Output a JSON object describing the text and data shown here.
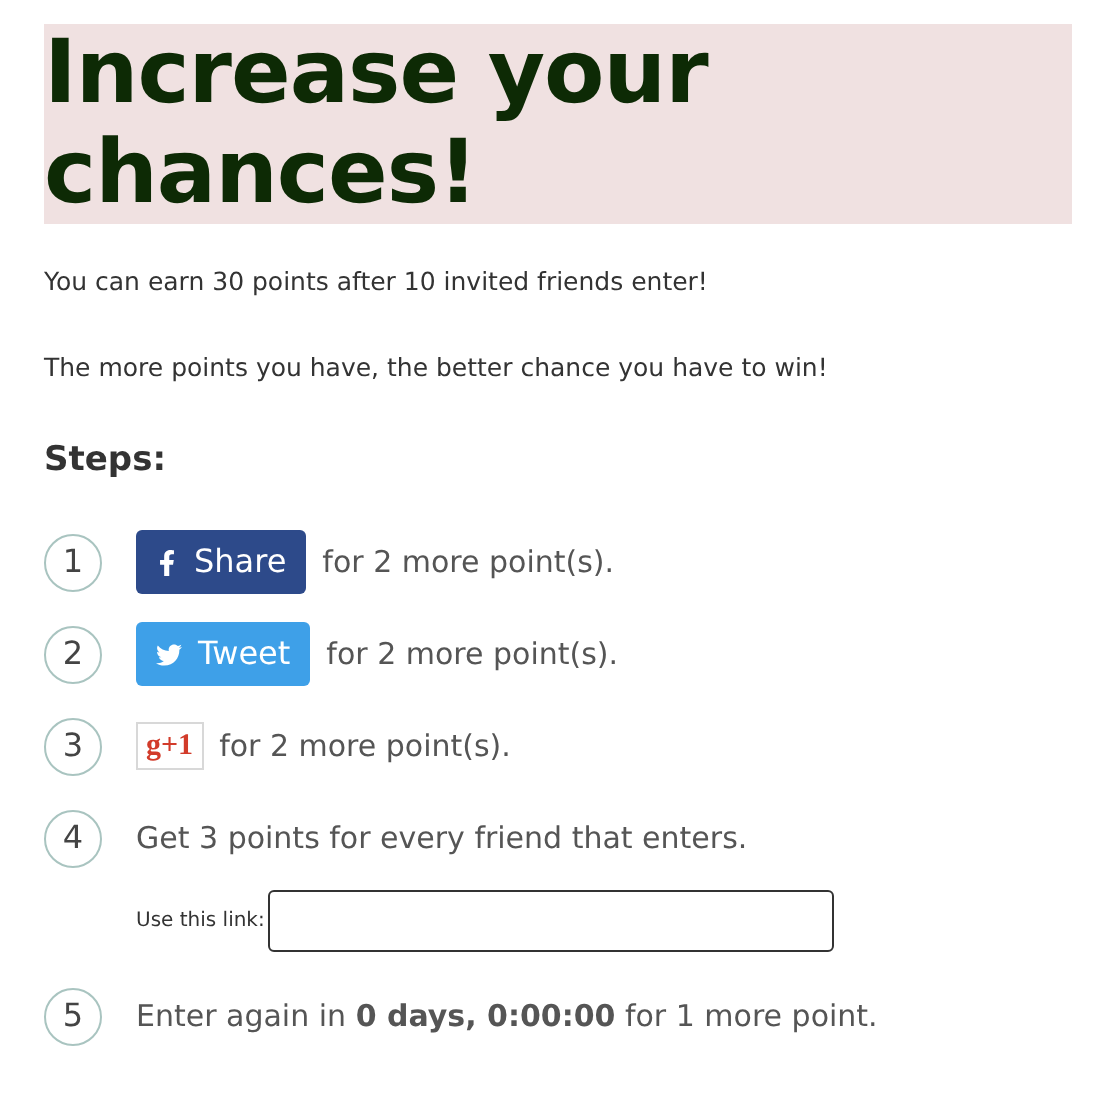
{
  "title": "Increase your chances!",
  "paragraphs": [
    "You can earn 30 points after 10 invited friends enter!",
    "The more points you have, the better chance you have to win!"
  ],
  "steps_heading": "Steps:",
  "steps": [
    {
      "number": "1",
      "kind": "share",
      "button": "Share",
      "text": "for 2 more point(s)."
    },
    {
      "number": "2",
      "kind": "tweet",
      "button": "Tweet",
      "text": "for 2 more point(s)."
    },
    {
      "number": "3",
      "kind": "plusone",
      "button": "g+1",
      "text": "for 2 more point(s)."
    },
    {
      "number": "4",
      "kind": "referral",
      "text": "Get 3 points for every friend that enters.",
      "link_label": "Use this link:"
    },
    {
      "number": "5",
      "kind": "text",
      "text": "Enter again in **0 days, 0:00:00** for 1 more point."
    }
  ]
}
